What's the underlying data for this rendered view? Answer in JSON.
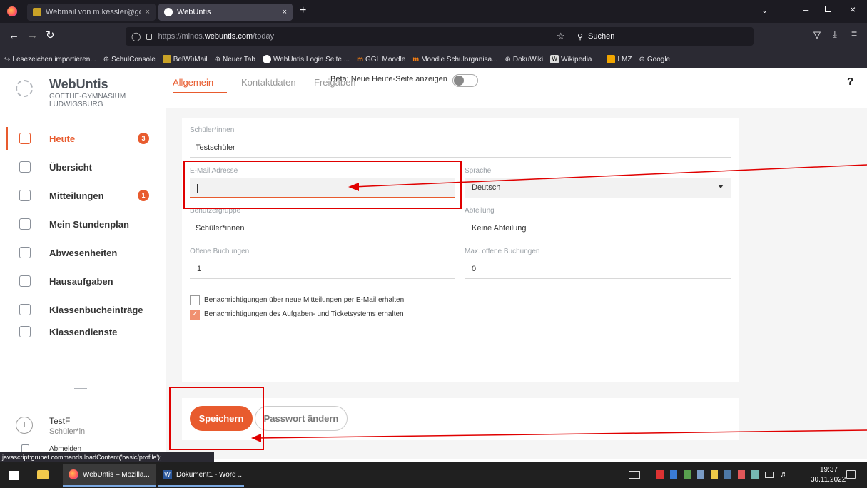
{
  "browser": {
    "tabs": [
      {
        "label": "Webmail von m.kessler@goethe",
        "active": false
      },
      {
        "label": "WebUntis",
        "active": true
      }
    ],
    "new_tab": "+",
    "url_prefix": "https://minos.",
    "url_domain": "webuntis.com",
    "url_path": "/today",
    "search_placeholder": "Suchen",
    "bookmarks": [
      "Lesezeichen importieren...",
      "SchulConsole",
      "BelWüMail",
      "Neuer Tab",
      "WebUntis Login Seite ...",
      "GGL Moodle",
      "Moodle Schulorganisa...",
      "DokuWiki",
      "Wikipedia",
      "LMZ",
      "Google"
    ],
    "status_text": "javascript:grupet.commands.loadContent('basic/profile');"
  },
  "app": {
    "brand": "WebUntis",
    "school_line1": "GOETHE-GYMNASIUM",
    "school_line2": "LUDWIGSBURG",
    "nav": [
      {
        "label": "Heute",
        "badge": "3",
        "active": true
      },
      {
        "label": "Übersicht"
      },
      {
        "label": "Mitteilungen",
        "badge": "1"
      },
      {
        "label": "Mein Stundenplan"
      },
      {
        "label": "Abwesenheiten"
      },
      {
        "label": "Hausaufgaben"
      },
      {
        "label": "Klassenbucheinträge"
      },
      {
        "label": "Klassendienste"
      }
    ],
    "user": {
      "initial": "T",
      "name": "TestF",
      "role": "Schüler*in",
      "logout": "Abmelden"
    },
    "tabs": [
      "Allgemein",
      "Kontaktdaten",
      "Freigaben"
    ],
    "beta_label": "Beta: Neue Heute-Seite anzeigen",
    "help": "?",
    "form": {
      "student_label": "Schüler*innen",
      "student_value": "Testschüler",
      "email_label": "E-Mail Adresse",
      "email_value": "",
      "language_label": "Sprache",
      "language_value": "Deutsch",
      "usergroup_label": "Benutzergruppe",
      "usergroup_value": "Schüler*innen",
      "department_label": "Abteilung",
      "department_value": "Keine Abteilung",
      "open_bookings_label": "Offene Buchungen",
      "open_bookings_value": "1",
      "max_bookings_label": "Max. offene Buchungen",
      "max_bookings_value": "0",
      "checkbox1_label": "Benachrichtigungen über neue Mitteilungen per E-Mail erhalten",
      "checkbox1_checked": false,
      "checkbox2_label": "Benachrichtigungen des Aufgaben- und Ticketsystems erhalten",
      "checkbox2_checked": true
    },
    "save_label": "Speichern",
    "change_password_label": "Passwort ändern"
  },
  "taskbar": {
    "apps": [
      "WebUntis – Mozilla...",
      "Dokument1 - Word ..."
    ],
    "time": "19:37",
    "date": "30.11.2022"
  },
  "colors": {
    "accent": "#e85b2e",
    "annotation": "#e00000"
  }
}
